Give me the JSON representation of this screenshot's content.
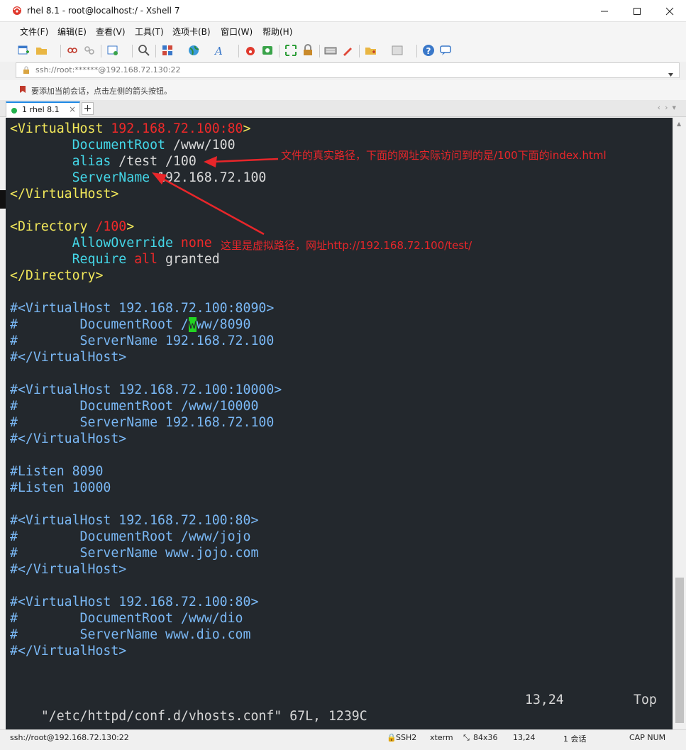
{
  "window": {
    "title": "rhel 8.1 - root@localhost:/ - Xshell 7"
  },
  "menu": [
    "文件(F)",
    "编辑(E)",
    "查看(V)",
    "工具(T)",
    "选项卡(B)",
    "窗口(W)",
    "帮助(H)"
  ],
  "address": {
    "value": "ssh://root:******@192.168.72.130:22"
  },
  "hint": {
    "text": "要添加当前会话，点击左侧的箭头按钮。"
  },
  "tab": {
    "label": "1 rhel 8.1",
    "close": "×",
    "add": "+"
  },
  "terminal": {
    "lines": [
      "<VirtualHost 192.168.72.100:80>",
      "        DocumentRoot /www/100",
      "        alias /test /100",
      "        ServerName 192.168.72.100",
      "</VirtualHost>",
      "",
      "<Directory /100>",
      "        AllowOverride none",
      "        Require all granted",
      "</Directory>",
      "",
      "#<VirtualHost 192.168.72.100:8090>",
      "#        DocumentRoot /www/8090",
      "#        ServerName 192.168.72.100",
      "#</VirtualHost>",
      "",
      "#<VirtualHost 192.168.72.100:10000>",
      "#        DocumentRoot /www/10000",
      "#        ServerName 192.168.72.100",
      "#</VirtualHost>",
      "",
      "#Listen 8090",
      "#Listen 10000",
      "",
      "#<VirtualHost 192.168.72.100:80>",
      "#        DocumentRoot /www/jojo",
      "#        ServerName www.jojo.com",
      "#</VirtualHost>",
      "",
      "#<VirtualHost 192.168.72.100:80>",
      "#        DocumentRoot /www/dio",
      "#        ServerName www.dio.com",
      "#</VirtualHost>"
    ],
    "status": {
      "file": "\"/etc/httpd/conf.d/vhosts.conf\" 67L, 1239C",
      "position": "13,24",
      "scroll": "Top"
    }
  },
  "annotations": {
    "note1": "文件的真实路径，下面的网址实际访问到的是/100下面的index.html",
    "note2": "这里是虚拟路径，网址http://192.168.72.100/test/"
  },
  "statusbar": {
    "connection": "ssh://root@192.168.72.130:22",
    "protocol": "SSH2",
    "term": "xterm",
    "size": "84x36",
    "cursor": "13,24",
    "sessions": "1 会话",
    "caps": "CAP NUM"
  },
  "colors": {
    "terminal_bg": "#23282d",
    "tag": "#f2e85a",
    "keyword": "#ef2929",
    "directive": "#44d7e8",
    "comment": "#7ab8f5",
    "cursor": "#22d422",
    "annotation": "#e8262a"
  }
}
